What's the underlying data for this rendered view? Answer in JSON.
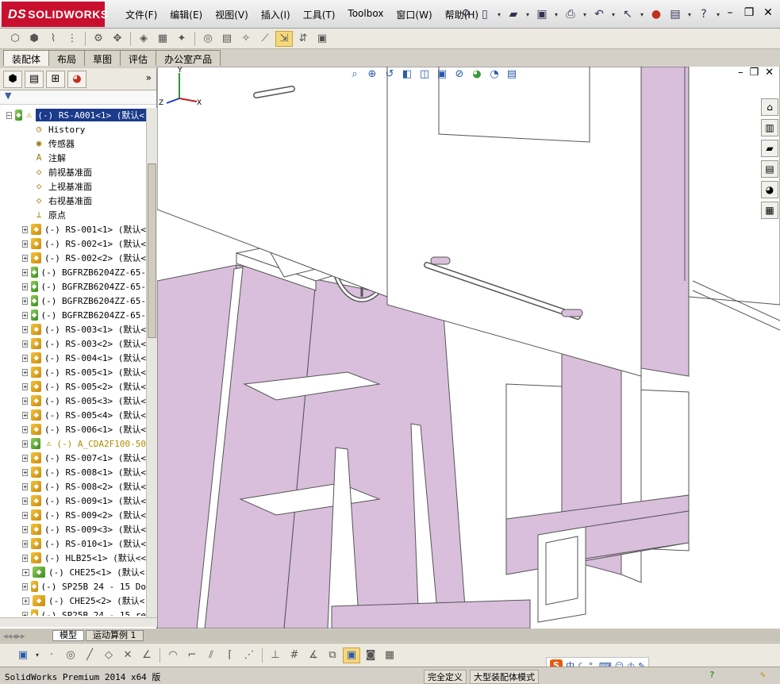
{
  "app": {
    "brand_prefix": "DS",
    "brand": "SOLIDWORKS"
  },
  "menu": [
    {
      "label": "文件(F)"
    },
    {
      "label": "编辑(E)"
    },
    {
      "label": "视图(V)"
    },
    {
      "label": "插入(I)"
    },
    {
      "label": "工具(T)"
    },
    {
      "label": "Toolbox"
    },
    {
      "label": "窗口(W)"
    },
    {
      "label": "帮助(H)"
    }
  ],
  "command_tabs": [
    {
      "label": "装配体",
      "active": true
    },
    {
      "label": "布局",
      "active": false
    },
    {
      "label": "草图",
      "active": false
    },
    {
      "label": "评估",
      "active": false
    },
    {
      "label": "办公室产品",
      "active": false
    }
  ],
  "feature_tree": {
    "filter_icon": "filter-icon",
    "root": "(-) RS-A001<1> (默认<",
    "system_items": [
      {
        "label": "History",
        "icon": "history-icon"
      },
      {
        "label": "传感器",
        "icon": "sensor-icon"
      },
      {
        "label": "注解",
        "icon": "annotation-icon"
      },
      {
        "label": "前视基准面",
        "icon": "plane-icon"
      },
      {
        "label": "上视基准面",
        "icon": "plane-icon"
      },
      {
        "label": "右视基准面",
        "icon": "plane-icon"
      },
      {
        "label": "原点",
        "icon": "origin-icon"
      }
    ],
    "components": [
      {
        "label": "(-) RS-001<1> (默认<",
        "kind": "part"
      },
      {
        "label": "(-) RS-002<1> (默认<",
        "kind": "part"
      },
      {
        "label": "(-) RS-002<2> (默认<",
        "kind": "part"
      },
      {
        "label": "(-) BGFRZB6204ZZ-65-",
        "kind": "partg"
      },
      {
        "label": "(-) BGFRZB6204ZZ-65-",
        "kind": "partg"
      },
      {
        "label": "(-) BGFRZB6204ZZ-65-",
        "kind": "partg"
      },
      {
        "label": "(-) BGFRZB6204ZZ-65-",
        "kind": "partg"
      },
      {
        "label": "(-) RS-003<1> (默认<",
        "kind": "part"
      },
      {
        "label": "(-) RS-003<2> (默认<",
        "kind": "part"
      },
      {
        "label": "(-) RS-004<1> (默认<",
        "kind": "part"
      },
      {
        "label": "(-) RS-005<1> (默认<",
        "kind": "part"
      },
      {
        "label": "(-) RS-005<2> (默认<",
        "kind": "part"
      },
      {
        "label": "(-) RS-005<3> (默认<",
        "kind": "part"
      },
      {
        "label": "(-) RS-005<4> (默认<",
        "kind": "part"
      },
      {
        "label": "(-) RS-006<1> (默认<",
        "kind": "part"
      },
      {
        "label": "(-) A_CDA2F100-50",
        "kind": "partg",
        "warning": true
      },
      {
        "label": "(-) RS-007<1> (默认<",
        "kind": "part"
      },
      {
        "label": "(-) RS-008<1> (默认<",
        "kind": "part"
      },
      {
        "label": "(-) RS-008<2> (默认<",
        "kind": "part"
      },
      {
        "label": "(-) RS-009<1> (默认<",
        "kind": "part"
      },
      {
        "label": "(-) RS-009<2> (默认<",
        "kind": "part"
      },
      {
        "label": "(-) RS-009<3> (默认<",
        "kind": "part"
      },
      {
        "label": "(-) RS-010<1> (默认<",
        "kind": "part"
      },
      {
        "label": "(-) HLB25<1> (默认<<",
        "kind": "part"
      },
      {
        "label": "(-) CHE25<1> (默认<",
        "kind": "partg"
      },
      {
        "label": "(-) SP25B 24 - 15 Do",
        "kind": "part"
      },
      {
        "label": "(-) CHE25<2> (默认<",
        "kind": "part"
      },
      {
        "label": "(-) SP25B 24 - 15 re",
        "kind": "part"
      }
    ]
  },
  "bottom_tabs": [
    {
      "label": "模型",
      "active": true
    },
    {
      "label": "运动算例 1",
      "active": false
    }
  ],
  "status": {
    "app_version": "SolidWorks Premium 2014 x64 版",
    "state": "完全定义",
    "mode": "大型装配体模式"
  },
  "ime": {
    "logo": "S",
    "lang": "中"
  },
  "colors": {
    "brand_red": "#c8102e",
    "part_fill": "#d9bfdc",
    "selection": "#1a3a8a"
  }
}
